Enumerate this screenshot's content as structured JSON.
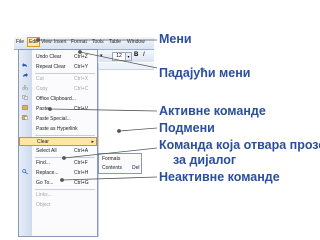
{
  "menubar": {
    "items": [
      "File",
      "Edit",
      "View",
      "Insert",
      "Format",
      "Tools",
      "Table",
      "Window"
    ]
  },
  "toolbar": {
    "font_size": "12"
  },
  "edit_menu": {
    "items": [
      {
        "label": "Undo Clear",
        "shortcut": "Ctrl+Z",
        "state": "enabled",
        "icon": "undo-icon"
      },
      {
        "label": "Repeat Clear",
        "shortcut": "Ctrl+Y",
        "state": "enabled",
        "icon": "redo-icon"
      },
      {
        "label": "Cut",
        "shortcut": "Ctrl+X",
        "state": "disabled",
        "icon": "scissors-icon"
      },
      {
        "label": "Copy",
        "shortcut": "Ctrl+C",
        "state": "disabled",
        "icon": "copy-icon"
      },
      {
        "label": "Office Clipboard...",
        "shortcut": "",
        "state": "enabled",
        "icon": "clipboard-icon"
      },
      {
        "label": "Paste",
        "shortcut": "Ctrl+V",
        "state": "enabled",
        "icon": "paste-icon"
      },
      {
        "label": "Paste Special...",
        "shortcut": "",
        "state": "enabled",
        "icon": ""
      },
      {
        "label": "Paste as Hyperlink",
        "shortcut": "",
        "state": "enabled",
        "icon": ""
      },
      {
        "label": "Clear",
        "shortcut": "",
        "state": "highlighted",
        "icon": "",
        "has_submenu": true
      },
      {
        "label": "Select All",
        "shortcut": "Ctrl+A",
        "state": "enabled",
        "icon": ""
      },
      {
        "label": "Find...",
        "shortcut": "Ctrl+F",
        "state": "enabled",
        "icon": "find-icon"
      },
      {
        "label": "Replace...",
        "shortcut": "Ctrl+H",
        "state": "enabled",
        "icon": ""
      },
      {
        "label": "Go To...",
        "shortcut": "Ctrl+G",
        "state": "enabled",
        "icon": ""
      },
      {
        "label": "Links...",
        "shortcut": "",
        "state": "disabled",
        "icon": ""
      },
      {
        "label": "Object",
        "shortcut": "",
        "state": "disabled",
        "icon": ""
      }
    ]
  },
  "submenu": {
    "items": [
      {
        "label": "Formats",
        "shortcut": ""
      },
      {
        "label": "Contents",
        "shortcut": "Del"
      }
    ]
  },
  "callouts": {
    "menu": "Мени",
    "dropdown": "Падајући мени",
    "active": "Активне команде",
    "submenu": "Подмени",
    "dialog_line1": "Команда која отвара прозор",
    "dialog_line2": "за дијалог",
    "inactive": "Неактивне команде"
  },
  "colors": {
    "callout_text": "#2a4f9d",
    "highlight": "#ffe7a2",
    "disabled_text": "#a7a7a7"
  }
}
